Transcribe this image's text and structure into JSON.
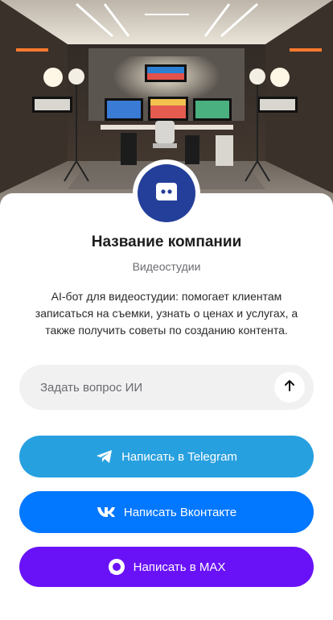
{
  "company": {
    "name": "Название компании",
    "category": "Видеостудии",
    "description": "AI-бот для видеостудии: помогает клиентам записаться на съемки, узнать о ценах и услугах, а также получить советы по созданию контента."
  },
  "ask": {
    "placeholder": "Задать вопрос ИИ",
    "send_icon": "arrow-up-icon"
  },
  "buttons": {
    "telegram": {
      "label": "Написать в Telegram",
      "icon": "telegram-icon",
      "color": "#27a0df"
    },
    "vk": {
      "label": "Написать Вконтакте",
      "icon": "vk-icon",
      "color": "#0277ff"
    },
    "max": {
      "label": "Написать в MAX",
      "icon": "max-icon",
      "color": "#6a12f7"
    }
  },
  "avatar": {
    "icon": "chat-bot-icon",
    "color": "#243f9a"
  }
}
